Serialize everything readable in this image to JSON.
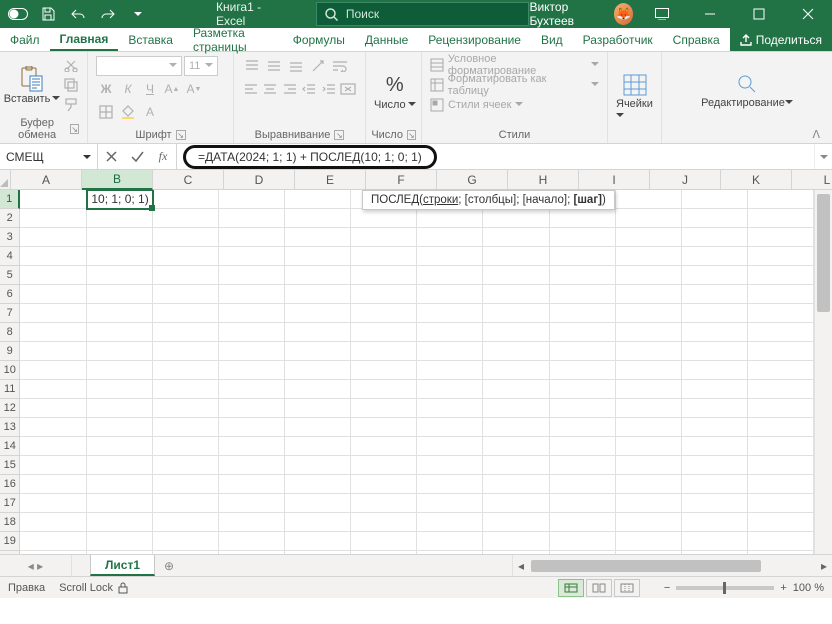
{
  "titlebar": {
    "title": "Книга1  -  Excel",
    "search_placeholder": "Поиск",
    "user_name": "Виктор Бухтеев"
  },
  "tabs": {
    "file": "Файл",
    "list": [
      "Главная",
      "Вставка",
      "Разметка страницы",
      "Формулы",
      "Данные",
      "Рецензирование",
      "Вид",
      "Разработчик",
      "Справка"
    ],
    "active_index": 0,
    "share": "Поделиться"
  },
  "ribbon": {
    "clipboard": {
      "paste": "Вставить",
      "label": "Буфер обмена"
    },
    "font": {
      "name": "",
      "size": "11",
      "label": "Шрифт"
    },
    "align": {
      "label": "Выравнивание"
    },
    "number": {
      "big": "Число",
      "label": "Число"
    },
    "styles": {
      "cond": "Условное форматирование",
      "table": "Форматировать как таблицу",
      "cell": "Стили ячеек",
      "label": "Стили"
    },
    "cells": {
      "label": "Ячейки"
    },
    "editing": {
      "label": "Редактирование"
    }
  },
  "formula_bar": {
    "name_box": "СМЕЩ",
    "formula": "=ДАТА(2024; 1; 1) + ПОСЛЕД(10; 1; 0; 1)"
  },
  "tooltip": {
    "fn": "ПОСЛЕД",
    "arg1": "строки",
    "arg2": "[столбцы]",
    "arg3": "[начало]",
    "arg4": "[шаг]"
  },
  "grid": {
    "columns": [
      "A",
      "B",
      "C",
      "D",
      "E",
      "F",
      "G",
      "H",
      "I",
      "J",
      "K",
      "L"
    ],
    "active_col_index": 1,
    "row_count": 20,
    "active_row": 1,
    "cells": {
      "B1": "10; 1; 0; 1)"
    }
  },
  "sheets": {
    "active": "Лист1"
  },
  "status": {
    "mode": "Правка",
    "scroll_lock": "Scroll Lock",
    "zoom_pct": "100 %"
  }
}
